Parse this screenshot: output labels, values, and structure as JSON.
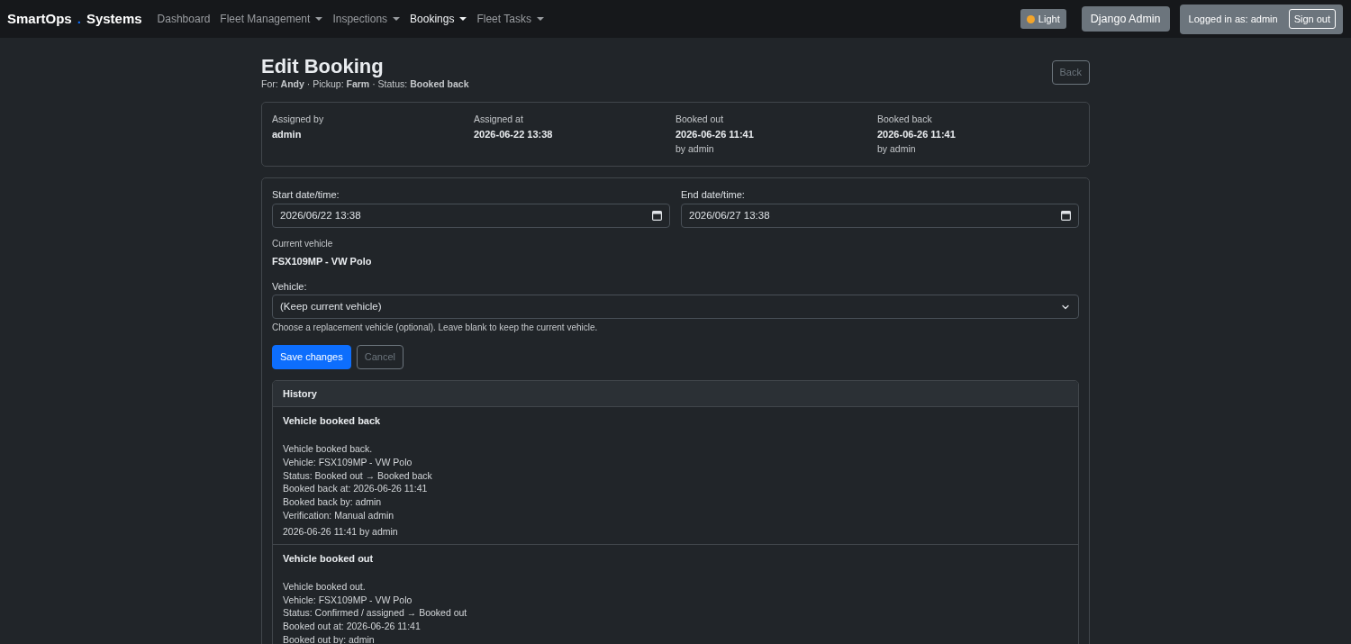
{
  "navbar": {
    "brand": {
      "left": "SmartOps",
      "separator": ".",
      "right": "Systems"
    },
    "links": [
      {
        "label": "Dashboard",
        "dropdown": false,
        "selected": false
      },
      {
        "label": "Fleet Management",
        "dropdown": true,
        "selected": false
      },
      {
        "label": "Inspections",
        "dropdown": true,
        "selected": false
      },
      {
        "label": "Bookings",
        "dropdown": true,
        "selected": true
      },
      {
        "label": "Fleet Tasks",
        "dropdown": true,
        "selected": false
      }
    ],
    "theme_button": "Light",
    "admin_button": "Django Admin",
    "user": {
      "label": "Logged in as: admin",
      "sign_out": "Sign out"
    }
  },
  "header": {
    "title": "Edit Booking",
    "subtitle": "For: **Andy** · Pickup: **Farm** · Status: **Booked back**",
    "back_button": "Back"
  },
  "summary": [
    {
      "label": "Assigned by",
      "value": "admin"
    },
    {
      "label": "Assigned at",
      "value": "2026-06-22 13:38"
    },
    {
      "label": "Booked out",
      "value": "2026-06-26 11:41",
      "by": "by admin"
    },
    {
      "label": "Booked back",
      "value": "2026-06-26 11:41",
      "by": "by admin"
    }
  ],
  "form": {
    "dates": [
      {
        "label": "Start date/time:",
        "value": "2026/06/22 13:38"
      },
      {
        "label": "End date/time:",
        "value": "2026/06/27 13:38"
      }
    ],
    "current_vehicle": {
      "label": "Current vehicle",
      "value": "FSX109MP - VW Polo"
    },
    "vehicle": {
      "label": "Vehicle:",
      "value": "(Keep current vehicle)",
      "help": "Choose a replacement vehicle (optional). Leave blank to keep the current vehicle."
    },
    "buttons": [
      {
        "label": "Save changes",
        "kind": "primary"
      },
      {
        "label": "Cancel",
        "kind": "outline"
      }
    ]
  },
  "history": {
    "title": "History",
    "entries": [
      {
        "title": "Vehicle booked back",
        "lines": [
          "Vehicle booked back.",
          "Vehicle: FSX109MP - VW Polo",
          "Status: Booked out → Booked back",
          "Booked back at: 2026-06-26 11:41",
          "Booked back by: admin",
          "Verification: Manual admin"
        ],
        "footer": "2026-06-26 11:41 by admin"
      },
      {
        "title": "Vehicle booked out",
        "lines": [
          "Vehicle booked out.",
          "Vehicle: FSX109MP - VW Polo",
          "Status: Confirmed / assigned → Booked out",
          "Booked out at: 2026-06-26 11:41",
          "Booked out by: admin"
        ]
      }
    ]
  }
}
